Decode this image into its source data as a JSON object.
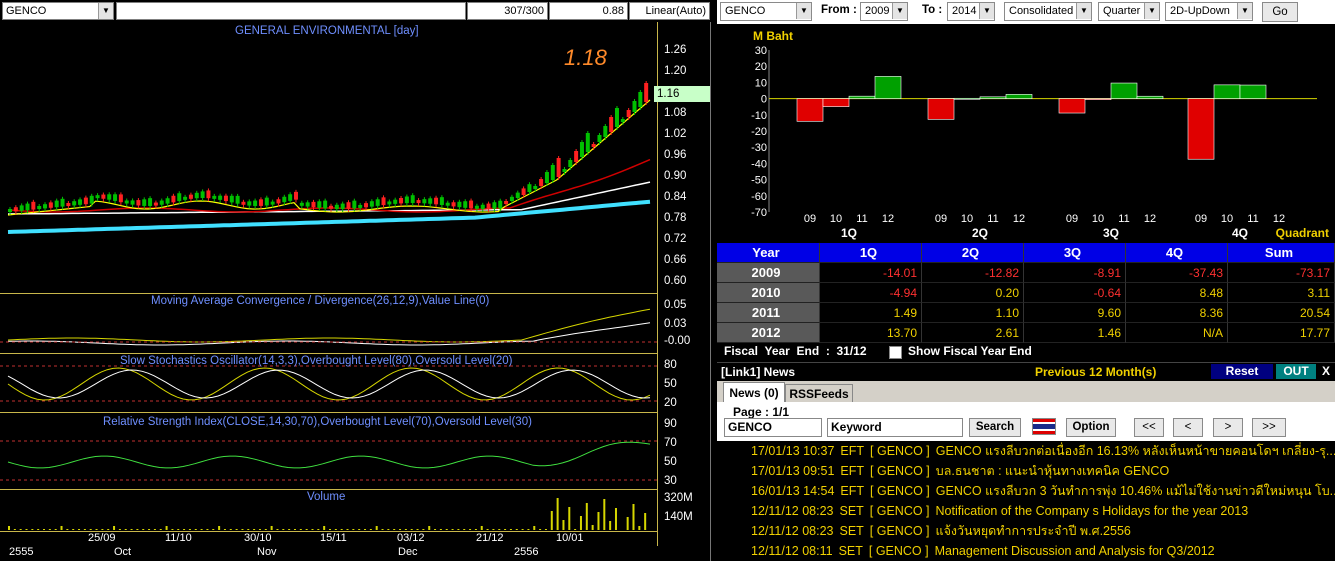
{
  "chart_toolbar": {
    "symbol": "GENCO",
    "count": "307/300",
    "price": "0.88",
    "scale": "Linear(Auto)"
  },
  "chart": {
    "main_title": "GENERAL ENVIRONMENTAL [day]",
    "last_price_label": "1.18",
    "current_price_tag": "1.16",
    "price_scale": [
      "1.26",
      "1.20",
      "1.14",
      "1.08",
      "1.02",
      "0.96",
      "0.90",
      "0.84",
      "0.78",
      "0.72",
      "0.66",
      "0.60"
    ],
    "macd_title": "Moving Average Convergence / Divergence(26,12,9),Value Line(0)",
    "macd_scale": [
      "0.05",
      "0.03",
      "-0.00"
    ],
    "stoch_title": "Slow Stochastics Oscillator(14,3,3),Overbought Level(80),Oversold Level(20)",
    "stoch_scale": [
      "80",
      "50",
      "20"
    ],
    "rsi_title": "Relative Strength Index(CLOSE,14,30,70),Overbought Level(70),Oversold Level(30)",
    "rsi_scale": [
      "90",
      "70",
      "50",
      "30"
    ],
    "volume_title": "Volume",
    "volume_scale": [
      "320M",
      "140M"
    ],
    "date_axis_days": [
      "25/09",
      "11/10",
      "30/10",
      "15/11",
      "03/12",
      "21/12",
      "10/01"
    ],
    "date_axis_months": [
      "2555",
      "Oct",
      "Nov",
      "Dec",
      "2556"
    ],
    "colors": {
      "ema_fast": "#ffffff",
      "ema_mid": "#d00000",
      "ema_slow": "#ffff00",
      "trend": "#40e0ff",
      "candle_up": "#00c000",
      "candle_down": "#ff2020",
      "title_blue": "#6f8fff",
      "price_orange": "#ff8a2a"
    }
  },
  "fin_toolbar": {
    "symbol": "GENCO",
    "from_label": "From :",
    "from_value": "2009",
    "to_label": "To :",
    "to_value": "2014",
    "type_value": "Consolidated",
    "period_value": "Quarter",
    "view_value": "2D-UpDown",
    "go_label": "Go"
  },
  "bar_chart": {
    "unit_label": "M Baht",
    "y_ticks": [
      "30",
      "20",
      "10",
      "0",
      "-10",
      "-20",
      "-30",
      "-40",
      "-50",
      "-60",
      "-70"
    ],
    "year_labels": [
      "09",
      "10",
      "11",
      "12"
    ],
    "quarter_labels": [
      "1Q",
      "2Q",
      "3Q",
      "4Q"
    ],
    "axis_label": "Quadrant"
  },
  "chart_data": {
    "type": "bar",
    "title": "",
    "ylabel": "M Baht",
    "xlabel": "Quadrant",
    "ylim": [
      -70,
      30
    ],
    "categories": [
      "1Q",
      "2Q",
      "3Q",
      "4Q"
    ],
    "series": [
      {
        "name": "09",
        "values": [
          -14.01,
          -12.82,
          -8.91,
          -37.43
        ]
      },
      {
        "name": "10",
        "values": [
          -4.94,
          0.2,
          -0.64,
          8.48
        ]
      },
      {
        "name": "11",
        "values": [
          1.49,
          1.1,
          9.6,
          8.36
        ]
      },
      {
        "name": "12",
        "values": [
          13.7,
          2.61,
          1.46,
          null
        ]
      }
    ]
  },
  "fin_table": {
    "headers": [
      "Year",
      "1Q",
      "2Q",
      "3Q",
      "4Q",
      "Sum"
    ],
    "rows": [
      {
        "year": "2009",
        "cells": [
          "-14.01",
          "-12.82",
          "-8.91",
          "-37.43",
          "-73.17"
        ]
      },
      {
        "year": "2010",
        "cells": [
          "-4.94",
          "0.20",
          "-0.64",
          "8.48",
          "3.11"
        ]
      },
      {
        "year": "2011",
        "cells": [
          "1.49",
          "1.10",
          "9.60",
          "8.36",
          "20.54"
        ]
      },
      {
        "year": "2012",
        "cells": [
          "13.70",
          "2.61",
          "1.46",
          "N/A",
          "17.77"
        ]
      }
    ],
    "fiscal_label": "Fiscal  Year  End  :  31/12",
    "show_fiscal_label": "Show Fiscal Year End"
  },
  "news": {
    "header_title": "[Link1] News",
    "period_label": "Previous 12 Month(s)",
    "reset_label": "Reset",
    "out_label": "OUT",
    "close_label": "X",
    "tabs": [
      "News (0)",
      "RSSFeeds"
    ],
    "page_label": "Page : 1/1",
    "symbol_value": "GENCO",
    "keyword_placeholder": "Keyword",
    "search_label": "Search",
    "option_label": "Option",
    "nav": [
      "<<",
      "<",
      ">",
      ">>"
    ],
    "items": [
      {
        "datetime": "17/01/13 10:37",
        "source": "EFT",
        "symbol": "[ GENCO ]",
        "headline": "GENCO แรงลีบวกต่อเนื่องอีก 16.13% หลังเห็นหน้าขายคอนโดฯ เกลี่ยง-รุ..."
      },
      {
        "datetime": "17/01/13 09:51",
        "source": "EFT",
        "symbol": "[ GENCO ]",
        "headline": "บล.ธนชาต : แนะนำหุ้นทางเทคนิค GENCO"
      },
      {
        "datetime": "16/01/13 14:54",
        "source": "EFT",
        "symbol": "[ GENCO ]",
        "headline": "GENCO แรงลีบวก 3 วันทำการพุ่ง 10.46% แม้ไม่ใช้งานข่าวดีใหม่หนุน โบ..."
      },
      {
        "datetime": "12/11/12 08:23",
        "source": "SET",
        "symbol": "[ GENCO ]",
        "headline": "Notification of the Company s Holidays for the year 2013"
      },
      {
        "datetime": "12/11/12 08:23",
        "source": "SET",
        "symbol": "[ GENCO ]",
        "headline": "แจ้งวันหยุดทำการประจำปี พ.ศ.2556"
      },
      {
        "datetime": "12/11/12 08:11",
        "source": "SET",
        "symbol": "[ GENCO ]",
        "headline": "Management Discussion and Analysis for Q3/2012"
      }
    ]
  }
}
